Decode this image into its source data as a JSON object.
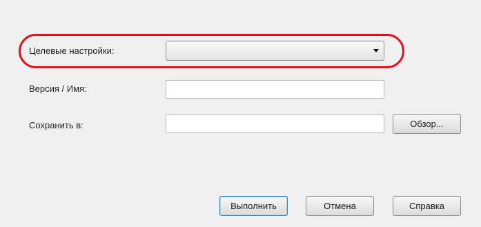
{
  "form": {
    "target_settings": {
      "label": "Целевые настройки:",
      "value": ""
    },
    "version_name": {
      "label": "Версия / Имя:",
      "value": ""
    },
    "save_to": {
      "label": "Сохранить в:",
      "value": ""
    },
    "browse_label": "Обзор..."
  },
  "actions": {
    "execute_label": "Выполнить",
    "cancel_label": "Отмена",
    "help_label": "Справка"
  },
  "colors": {
    "highlight": "#e3111b",
    "background": "#f0f0f0",
    "default_button_border": "#3c7fb1"
  },
  "icons": {
    "dropdown": "chevron-down-icon"
  }
}
